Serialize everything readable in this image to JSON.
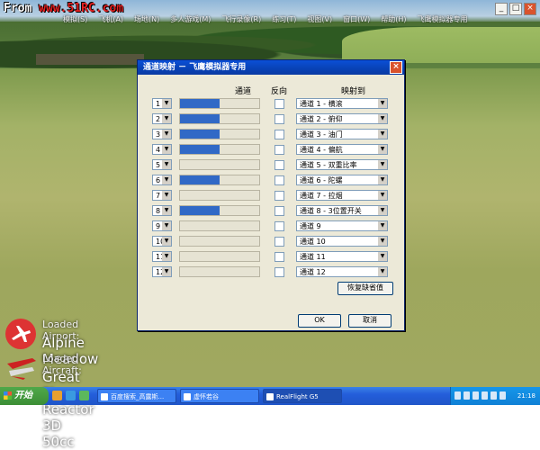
{
  "watermark": {
    "prefix": "From ",
    "site": "www.51RC.com"
  },
  "app": {
    "title": "RealFlight G5",
    "window_title": "飞鹰模拟器专用",
    "menu": [
      "模拟(S)",
      "飞机(A)",
      "场地(N)",
      "多人游戏(M)",
      "飞行录像(R)",
      "练习(T)",
      "视图(V)",
      "窗口(W)",
      "帮助(H)"
    ],
    "window_buttons": [
      "_",
      "□",
      "×"
    ]
  },
  "dialog": {
    "title": "通道映射 － 飞鹰模拟器专用",
    "close": "×",
    "headers": {
      "channel": "通道",
      "reverse": "反向",
      "mapping": "映射到"
    },
    "rows": [
      {
        "channel": "1",
        "level": 0.5,
        "mapping": "通道 1 - 横滚"
      },
      {
        "channel": "2",
        "level": 0.5,
        "mapping": "通道 2 - 俯仰"
      },
      {
        "channel": "3",
        "level": 0.5,
        "mapping": "通道 3 - 油门"
      },
      {
        "channel": "4",
        "level": 0.5,
        "mapping": "通道 4 - 偏航"
      },
      {
        "channel": "5",
        "level": 0,
        "mapping": "通道 5 - 双重比率"
      },
      {
        "channel": "6",
        "level": 0.5,
        "mapping": "通道 6 - 陀螺"
      },
      {
        "channel": "7",
        "level": 0,
        "mapping": "通道 7 - 拉烟"
      },
      {
        "channel": "8",
        "level": 0.5,
        "mapping": "通道 8 - 3位置开关"
      },
      {
        "channel": "9",
        "level": 0,
        "mapping": "通道 9"
      },
      {
        "channel": "10",
        "level": 0,
        "mapping": "通道 10"
      },
      {
        "channel": "11",
        "level": 0,
        "mapping": "通道 11"
      },
      {
        "channel": "12",
        "level": 0,
        "mapping": "通道 12"
      }
    ],
    "restore_defaults": "恢复缺省值",
    "ok": "OK",
    "cancel": "取消"
  },
  "overlay": {
    "airport_label": "Loaded Airport:",
    "airport_name": "Alpine Meadow",
    "aircraft_label": "Loaded Aircraft:",
    "aircraft_name": "Great Planes Reactor 3D 50cc"
  },
  "taskbar": {
    "start": "开始",
    "buttons": [
      "百度搜索_高露斯...",
      "虚怀若谷",
      "RealFlight G5"
    ],
    "time": "21:18"
  },
  "colors": {
    "accent": "#3169c6",
    "titlebar": "#0842b5",
    "taskbar": "#245edb"
  }
}
